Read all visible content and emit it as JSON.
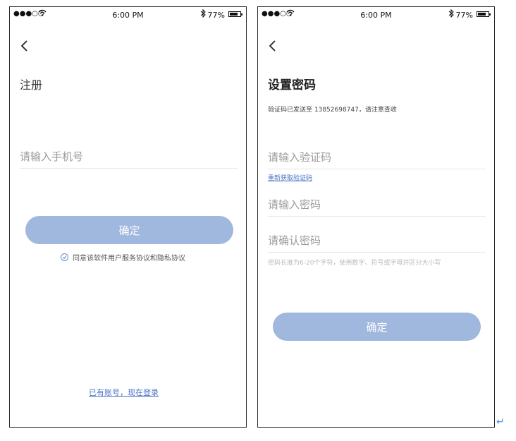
{
  "status_bar": {
    "signal": "●●●○○",
    "time": "6:00 PM",
    "battery": "77%"
  },
  "register": {
    "title": "注册",
    "phone_placeholder": "请输入手机号",
    "confirm_label": "确定",
    "agree_text": "同意该软件用户服务协议和隐私协议",
    "login_link": "已有账号，现在登录"
  },
  "set_password": {
    "title": "设置密码",
    "sent_notice": "验证码已发送至 13852698747，请注意查收",
    "code_placeholder": "请输入验证码",
    "resend_link": "重新获取验证码",
    "password_placeholder": "请输入密码",
    "confirm_password_placeholder": "请确认密码",
    "password_hint": "密码长度为6-20个字符，使用数字、符号或字母并区分大小写",
    "confirm_label": "确定"
  },
  "colors": {
    "button": "#a0b7de",
    "link": "#4a72c4"
  },
  "icons": [
    "back-icon",
    "wifi-icon",
    "bluetooth-icon",
    "battery-icon",
    "checkbox-icon",
    "return-icon"
  ],
  "return_glyph": "↵"
}
